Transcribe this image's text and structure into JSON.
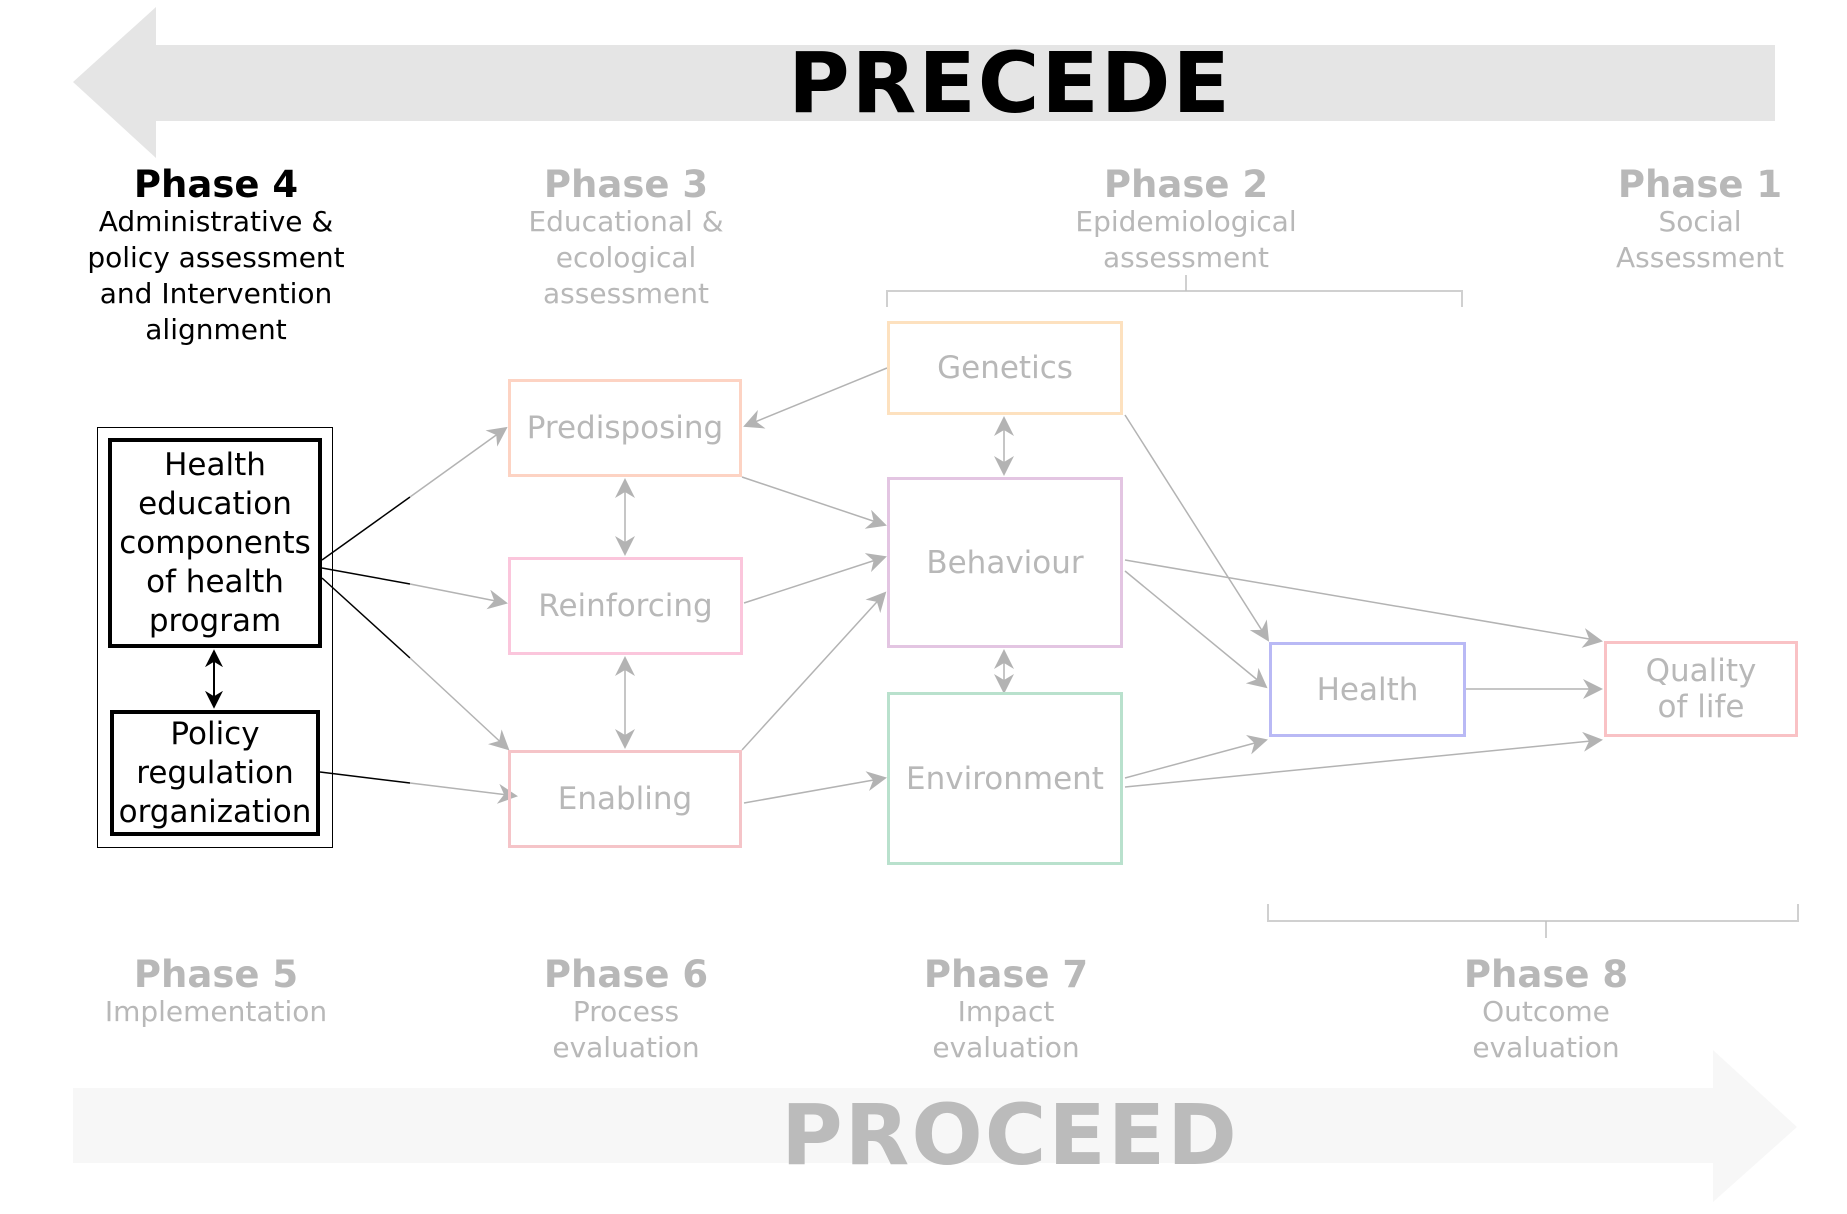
{
  "precede": {
    "label": "PRECEDE",
    "color": "#000000",
    "arrow_color": "#e5e5e5"
  },
  "proceed": {
    "label": "PROCEED",
    "color": "#bbbbbb",
    "arrow_color": "#f7f7f7"
  },
  "phases": {
    "phase4": {
      "title": "Phase 4",
      "lines": [
        "Administrative &",
        "policy assessment",
        "and Intervention",
        "alignment"
      ],
      "state": "active"
    },
    "phase3": {
      "title": "Phase 3",
      "lines": [
        "Educational &",
        "ecological",
        "assessment"
      ],
      "state": "muted"
    },
    "phase2": {
      "title": "Phase 2",
      "lines": [
        "Epidemiological",
        "assessment"
      ],
      "state": "muted"
    },
    "phase1": {
      "title": "Phase 1",
      "lines": [
        "Social",
        "Assessment"
      ],
      "state": "muted"
    },
    "phase5": {
      "title": "Phase 5",
      "lines": [
        "Implementation"
      ],
      "state": "muted"
    },
    "phase6": {
      "title": "Phase 6",
      "lines": [
        "Process",
        "evaluation"
      ],
      "state": "muted"
    },
    "phase7": {
      "title": "Phase 7",
      "lines": [
        "Impact",
        "evaluation"
      ],
      "state": "muted"
    },
    "phase8": {
      "title": "Phase 8",
      "lines": [
        "Outcome",
        "evaluation"
      ],
      "state": "muted"
    }
  },
  "nodes": {
    "health_education": {
      "lines": [
        "Health",
        "education",
        "components",
        "of health",
        "program"
      ],
      "color": "#000000"
    },
    "policy": {
      "lines": [
        "Policy",
        "regulation",
        "organization"
      ],
      "color": "#000000"
    },
    "predisposing": {
      "label": "Predisposing",
      "color": "#fdd3c3"
    },
    "reinforcing": {
      "label": "Reinforcing",
      "color": "#fbc6dc"
    },
    "enabling": {
      "label": "Enabling",
      "color": "#f5c4c8"
    },
    "genetics": {
      "label": "Genetics",
      "color": "#fde1bf"
    },
    "behaviour": {
      "label": "Behaviour",
      "color": "#e3c5e2"
    },
    "environment": {
      "label": "Environment",
      "color": "#b9e1cd"
    },
    "health": {
      "label": "Health",
      "color": "#b9b9f5"
    },
    "quality_of_life": {
      "lines": [
        "Quality",
        "of life"
      ],
      "color": "#f9c2c5"
    }
  },
  "connector_color": "#b3b3b3"
}
